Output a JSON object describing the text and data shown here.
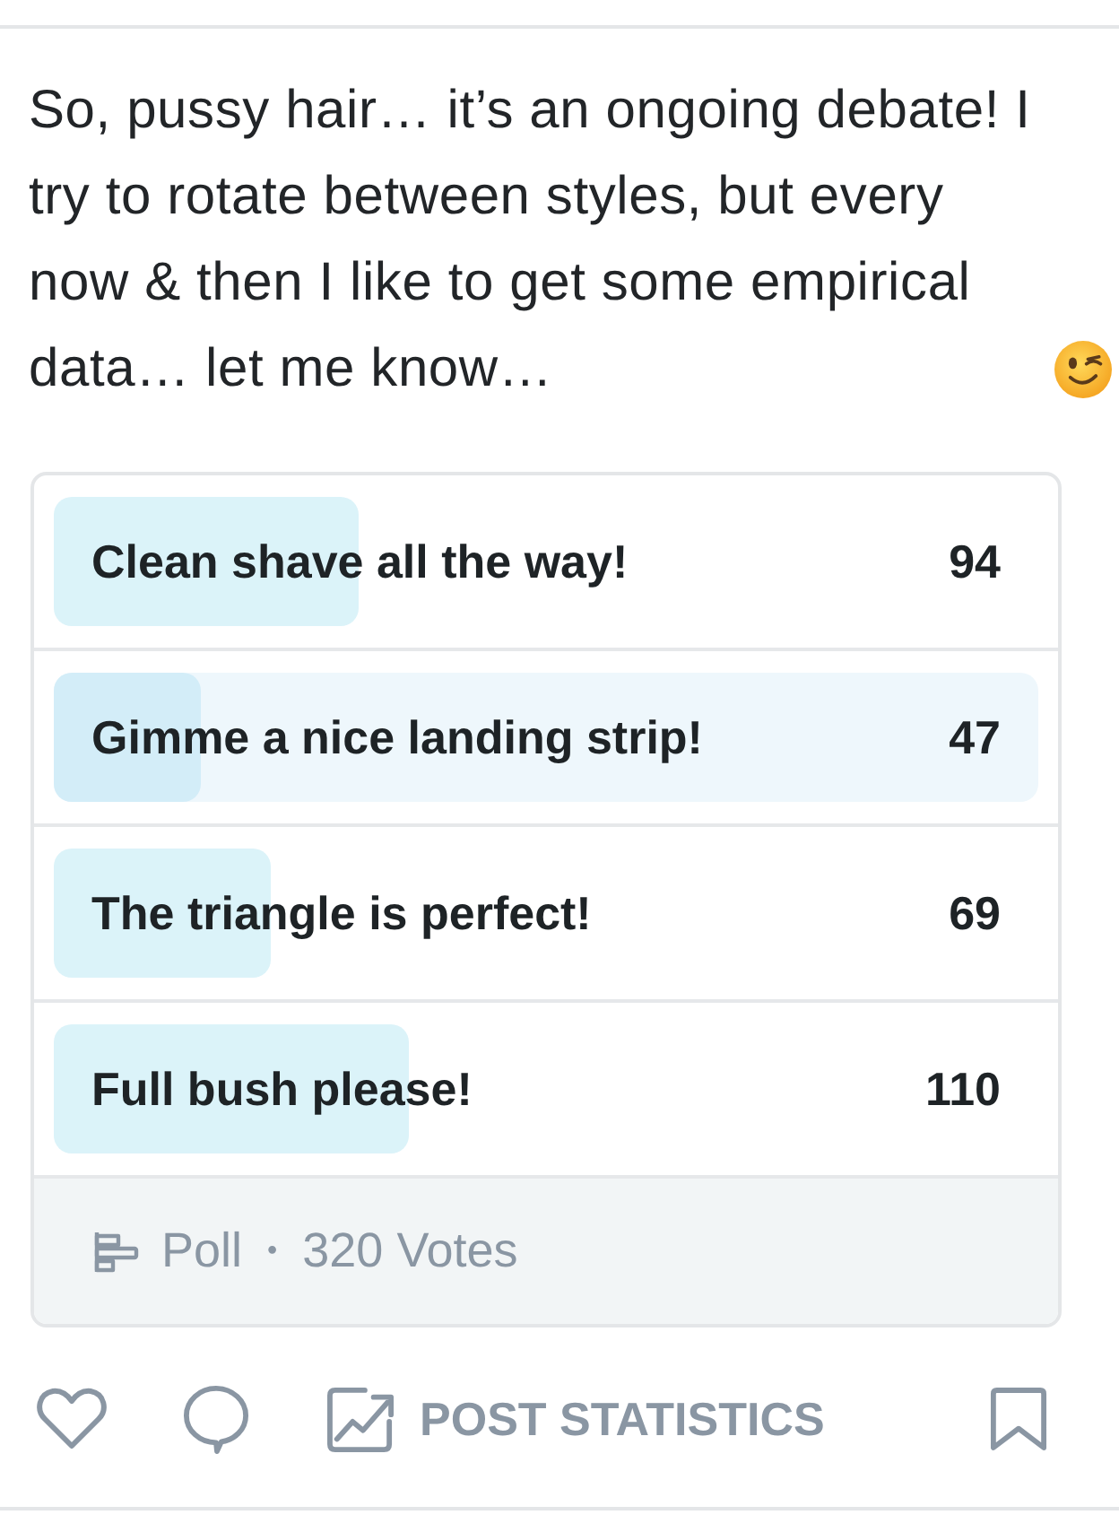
{
  "post": {
    "text": "So, pussy hair… it’s an ongoing debate! I try to rotate between styles, but every now & then I like to get some empirical data… let me know…"
  },
  "poll": {
    "options": [
      {
        "label": "Clean shave all the way!",
        "votes": "94",
        "level": 0.31,
        "selected": false
      },
      {
        "label": "Gimme a nice landing strip!",
        "votes": "47",
        "level": 0.15,
        "selected": true
      },
      {
        "label": "The triangle is perfect!",
        "votes": "69",
        "level": 0.22,
        "selected": false
      },
      {
        "label": "Full bush please!",
        "votes": "110",
        "level": 0.36,
        "selected": false
      }
    ],
    "footer": {
      "label": "Poll",
      "separator": "•",
      "votes": "320 Votes"
    }
  },
  "actions": {
    "statistics_label": "POST STATISTICS"
  }
}
